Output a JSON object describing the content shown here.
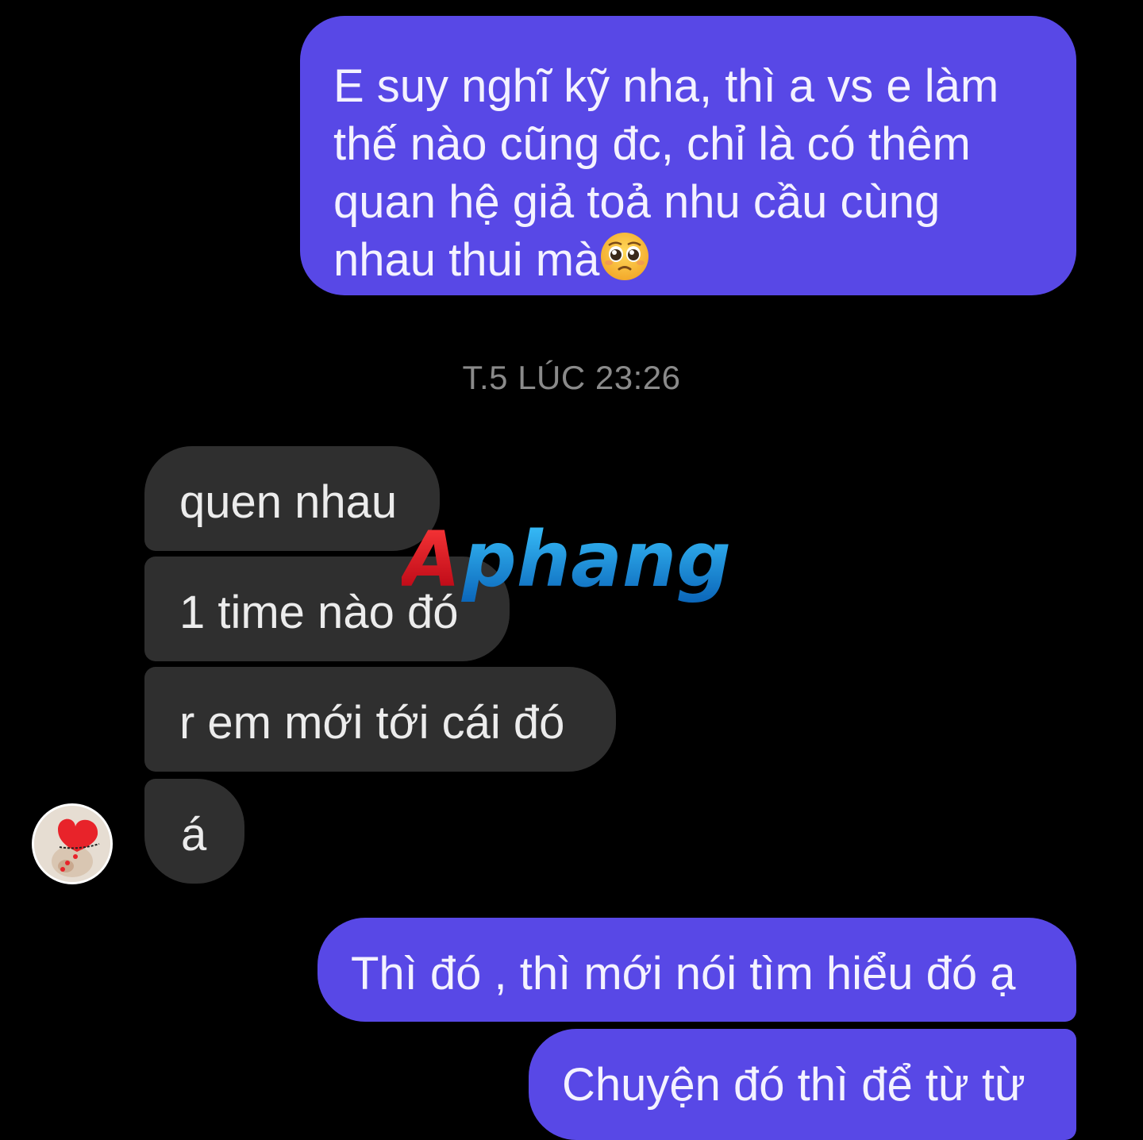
{
  "conversation": {
    "messages_sent_top": {
      "lines": [
        "E suy nghĩ kỹ nha, thì a vs e làm",
        "thế nào cũng đc, chỉ là có thêm",
        "quan hệ giả toả nhu cầu cùng",
        "nhau thui mà"
      ],
      "emoji": "pleading-face-icon"
    },
    "timestamp": "T.5 LÚC 23:26",
    "received": [
      "quen nhau",
      "1 time nào đó",
      "r em mới tới cái đó",
      "á"
    ],
    "sent_bottom": [
      "Thì đó , thì mới nói tìm hiểu đó ạ",
      "Chuyện đó thì để từ từ"
    ]
  },
  "watermark": {
    "text": "Aphang"
  },
  "colors": {
    "background": "#000000",
    "sent_bubble": "#5848e6",
    "received_bubble": "#2f2f2f",
    "timestamp": "#8a8a8a"
  }
}
